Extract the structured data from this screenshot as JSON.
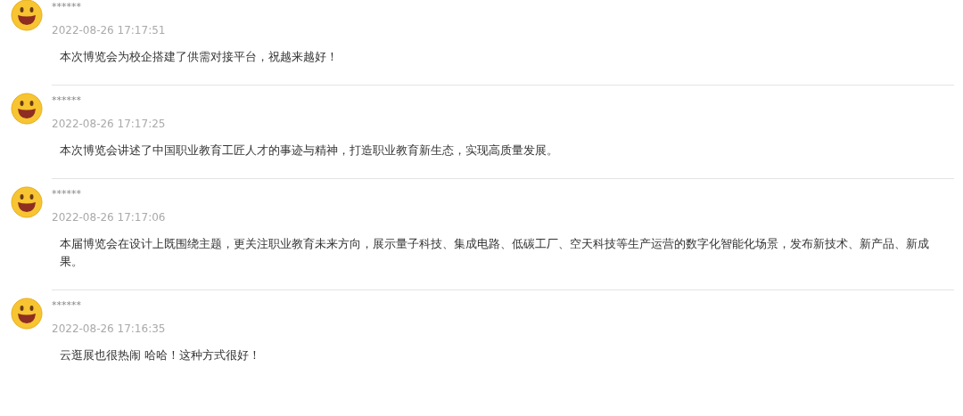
{
  "comments": [
    {
      "user": "******",
      "time": "2022-08-26 17:17:51",
      "text": "本次博览会为校企搭建了供需对接平台，祝越来越好！"
    },
    {
      "user": "******",
      "time": "2022-08-26 17:17:25",
      "text": "本次博览会讲述了中国职业教育工匠人才的事迹与精神，打造职业教育新生态，实现高质量发展。"
    },
    {
      "user": "******",
      "time": "2022-08-26 17:17:06",
      "text": "本届博览会在设计上既围绕主题，更关注职业教育未来方向，展示量子科技、集成电路、低碳工厂、空天科技等生产运营的数字化智能化场景，发布新技术、新产品、新成果。"
    },
    {
      "user": "******",
      "time": "2022-08-26 17:16:35",
      "text": "云逛展也很热闹 哈哈！这种方式很好！"
    }
  ]
}
